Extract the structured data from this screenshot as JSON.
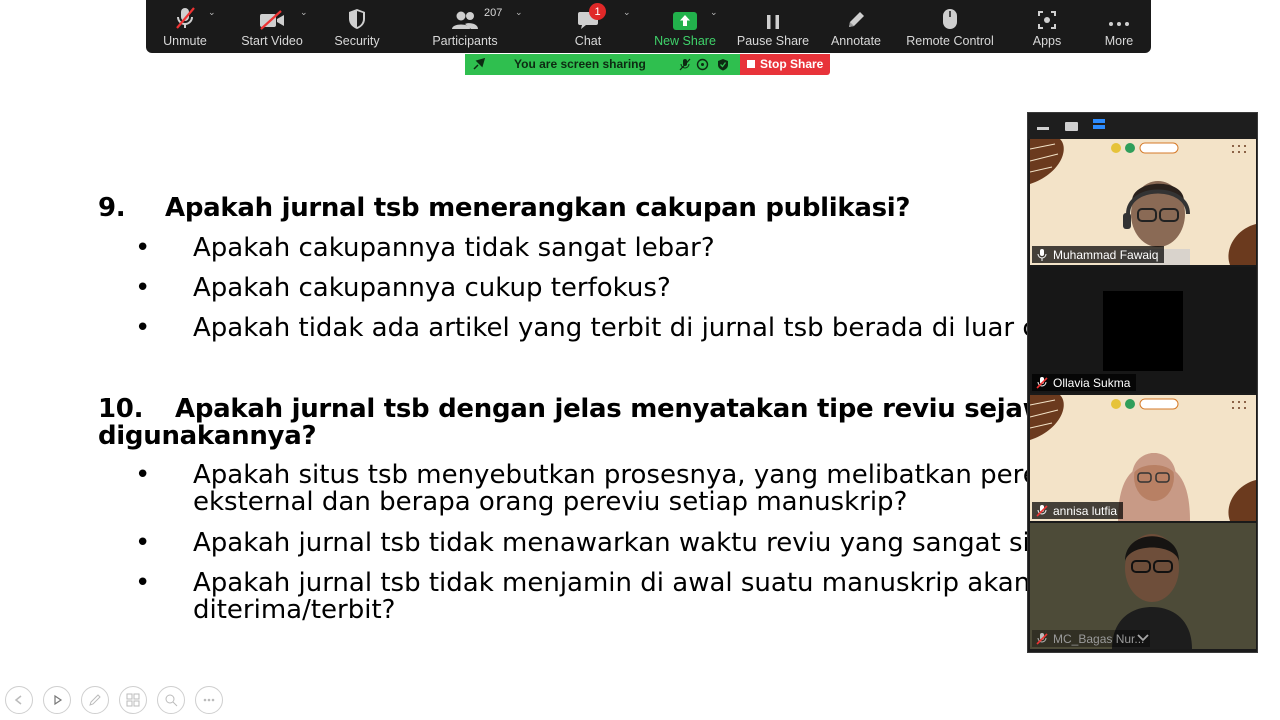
{
  "toolbar": {
    "unmute": "Unmute",
    "start_video": "Start Video",
    "security": "Security",
    "participants": "Participants",
    "participant_count": "207",
    "chat": "Chat",
    "chat_badge": "1",
    "new_share": "New Share",
    "pause_share": "Pause Share",
    "annotate": "Annotate",
    "remote_control": "Remote Control",
    "apps": "Apps",
    "more": "More",
    "accent_green": "#3fd26a"
  },
  "sharing": {
    "status": "You are screen sharing",
    "stop": "Stop Share"
  },
  "slide": {
    "q9_num": "9.",
    "q9": "Apakah jurnal tsb menerangkan cakupan publikasi?",
    "q9_b1": "Apakah cakupannya tidak sangat lebar?",
    "q9_b2": "Apakah cakupannya cukup terfokus?",
    "q9_b3": "Apakah tidak ada artikel yang terbit di jurnal tsb berada di luar ca",
    "q10_num": "10.",
    "q10_l1": "Apakah jurnal tsb dengan jelas menyatakan tipe reviu sejawat ya",
    "q10_l2": "digunakannya?",
    "q10_b1_l1": "Apakah situs tsb menyebutkan prosesnya, yang melibatkan perev",
    "q10_b1_l2": "eksternal dan berapa orang pereviu setiap manuskrip?",
    "q10_b2": "Apakah jurnal tsb tidak menawarkan waktu reviu yang sangat sin",
    "q10_b3_l1": "Apakah jurnal tsb tidak menjamin di awal suatu manuskrip akan",
    "q10_b3_l2": "diterima/terbit?",
    "bullet": "•"
  },
  "participants": [
    {
      "name": "Muhammad Fawaiq"
    },
    {
      "name": "Ollavia Sukma"
    },
    {
      "name": "annisa lutfia"
    },
    {
      "name": "MC_Bagas Nur..."
    }
  ]
}
